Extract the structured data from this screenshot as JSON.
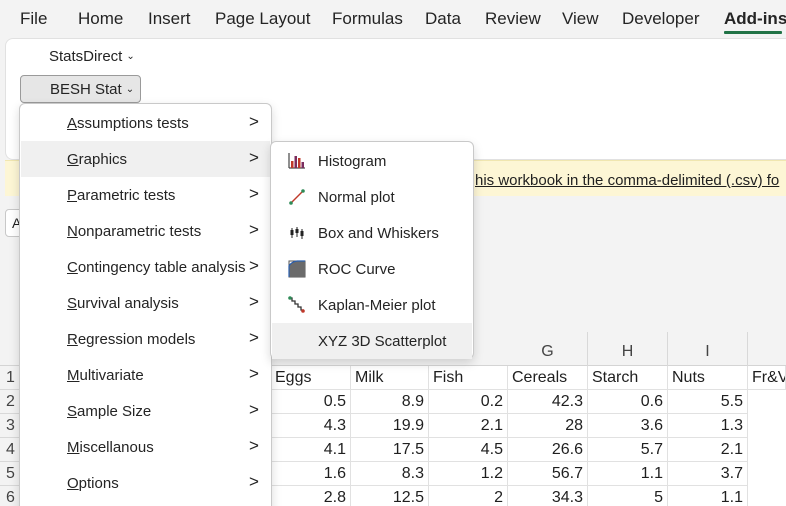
{
  "ribbon": {
    "tabs": [
      {
        "label": "File"
      },
      {
        "label": "Home"
      },
      {
        "label": "Insert"
      },
      {
        "label": "Page Layout"
      },
      {
        "label": "Formulas"
      },
      {
        "label": "Data"
      },
      {
        "label": "Review"
      },
      {
        "label": "View"
      },
      {
        "label": "Developer"
      },
      {
        "label": "Add-ins",
        "active": true
      }
    ],
    "statsdirect_label": "StatsDirect",
    "besh_label": "BESH Stat"
  },
  "infobar": {
    "text": "his workbook in the comma-delimited (.csv) fo"
  },
  "namebox": {
    "value": "A"
  },
  "menu": {
    "items": [
      {
        "key": "A",
        "rest": "ssumptions tests"
      },
      {
        "key": "G",
        "rest": "raphics"
      },
      {
        "key": "P",
        "rest": "arametric tests"
      },
      {
        "key": "N",
        "rest": "onparametric tests"
      },
      {
        "key": "C",
        "rest": "ontingency table analysis"
      },
      {
        "key": "S",
        "rest": "urvival analysis"
      },
      {
        "key": "R",
        "rest": "egression models"
      },
      {
        "key": "M",
        "rest": "ultivariate"
      },
      {
        "key": "S",
        "rest": "ample Size"
      },
      {
        "key": "M",
        "rest": "iscellanous"
      },
      {
        "key": "O",
        "rest": "ptions"
      }
    ],
    "arrow": ">"
  },
  "submenu": {
    "items": [
      {
        "label": "Histogram",
        "icon": "histogram-icon"
      },
      {
        "label": "Normal plot",
        "icon": "normal-plot-icon"
      },
      {
        "label": "Box and Whiskers",
        "icon": "box-whiskers-icon"
      },
      {
        "label": "ROC Curve",
        "icon": "roc-curve-icon"
      },
      {
        "label": "Kaplan-Meier plot",
        "icon": "kaplan-meier-icon"
      },
      {
        "label": "XYZ 3D Scatterplot",
        "icon": ""
      }
    ]
  },
  "sheet": {
    "col_letters": [
      "G",
      "H",
      "I"
    ],
    "row_numbers": [
      "1",
      "2",
      "3",
      "4",
      "5",
      "6"
    ],
    "header_row": [
      "Eggs",
      "Milk",
      "Fish",
      "Cereals",
      "Starch",
      "Nuts",
      "Fr&V"
    ],
    "rows": [
      [
        "0.5",
        "8.9",
        "0.2",
        "42.3",
        "0.6",
        "5.5"
      ],
      [
        "4.3",
        "19.9",
        "2.1",
        "28",
        "3.6",
        "1.3"
      ],
      [
        "4.1",
        "17.5",
        "4.5",
        "26.6",
        "5.7",
        "2.1"
      ],
      [
        "1.6",
        "8.3",
        "1.2",
        "56.7",
        "1.1",
        "3.7"
      ],
      [
        "2.8",
        "12.5",
        "2",
        "34.3",
        "5",
        "1.1"
      ]
    ]
  },
  "colors": {
    "accent_green": "#217346",
    "infobar_bg": "#fdf6d5",
    "menu_hover": "#f0f0f0",
    "icon_red": "#c0392b",
    "icon_green": "#2e8b57"
  }
}
